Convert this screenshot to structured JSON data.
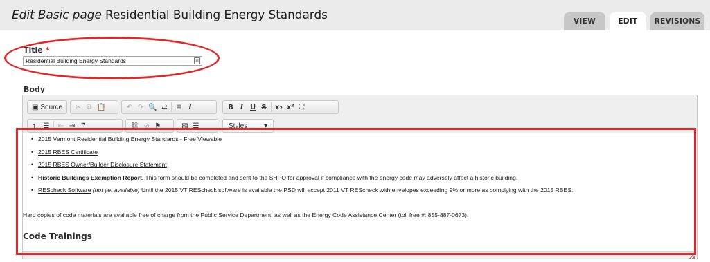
{
  "page": {
    "title_prefix": "Edit Basic page",
    "title_main": "Residential Building Energy Standards"
  },
  "tabs": [
    {
      "label": "VIEW"
    },
    {
      "label": "EDIT"
    },
    {
      "label": "REVISIONS"
    }
  ],
  "form": {
    "title_label": "Title",
    "required_mark": "*",
    "title_value": "Residential Building Energy Standards",
    "body_label": "Body"
  },
  "toolbar": {
    "source_label": "Source",
    "styles_label": "Styles",
    "bold": "B",
    "italic": "I",
    "underline": "U",
    "strike": "S",
    "subscript": "x₂",
    "superscript": "x²"
  },
  "content": {
    "items": [
      {
        "link": "2015 Vermont Residential Building Energy Standards - Free Viewable"
      },
      {
        "link": "2015 RBES Certificate"
      },
      {
        "link": "2015 RBES Owner/Builder Disclosure Statement"
      },
      {
        "bold": "Historic Buildings Exemption Report.",
        "text": " This form should be completed and sent to the SHPO for approval if compliance with the energy code may adversely affect a historic building."
      },
      {
        "link": "REScheck Software",
        "note": " (not yet available)",
        "text": " Until the 2015 VT REScheck software is available the PSD will accept 2011 VT REScheck with envelopes exceeding 9% or more as complying with the 2015 RBES."
      }
    ],
    "paragraph": "Hard copies of code materials are available free of charge from the Public Service Department, as well as the Energy Code Assistance Center (toll free #: 855-887-0673).",
    "heading": "Code Trainings"
  },
  "colors": {
    "annotation_red": "#e02a2a",
    "header_bg": "#ebebeb",
    "required": "#e0301e"
  }
}
